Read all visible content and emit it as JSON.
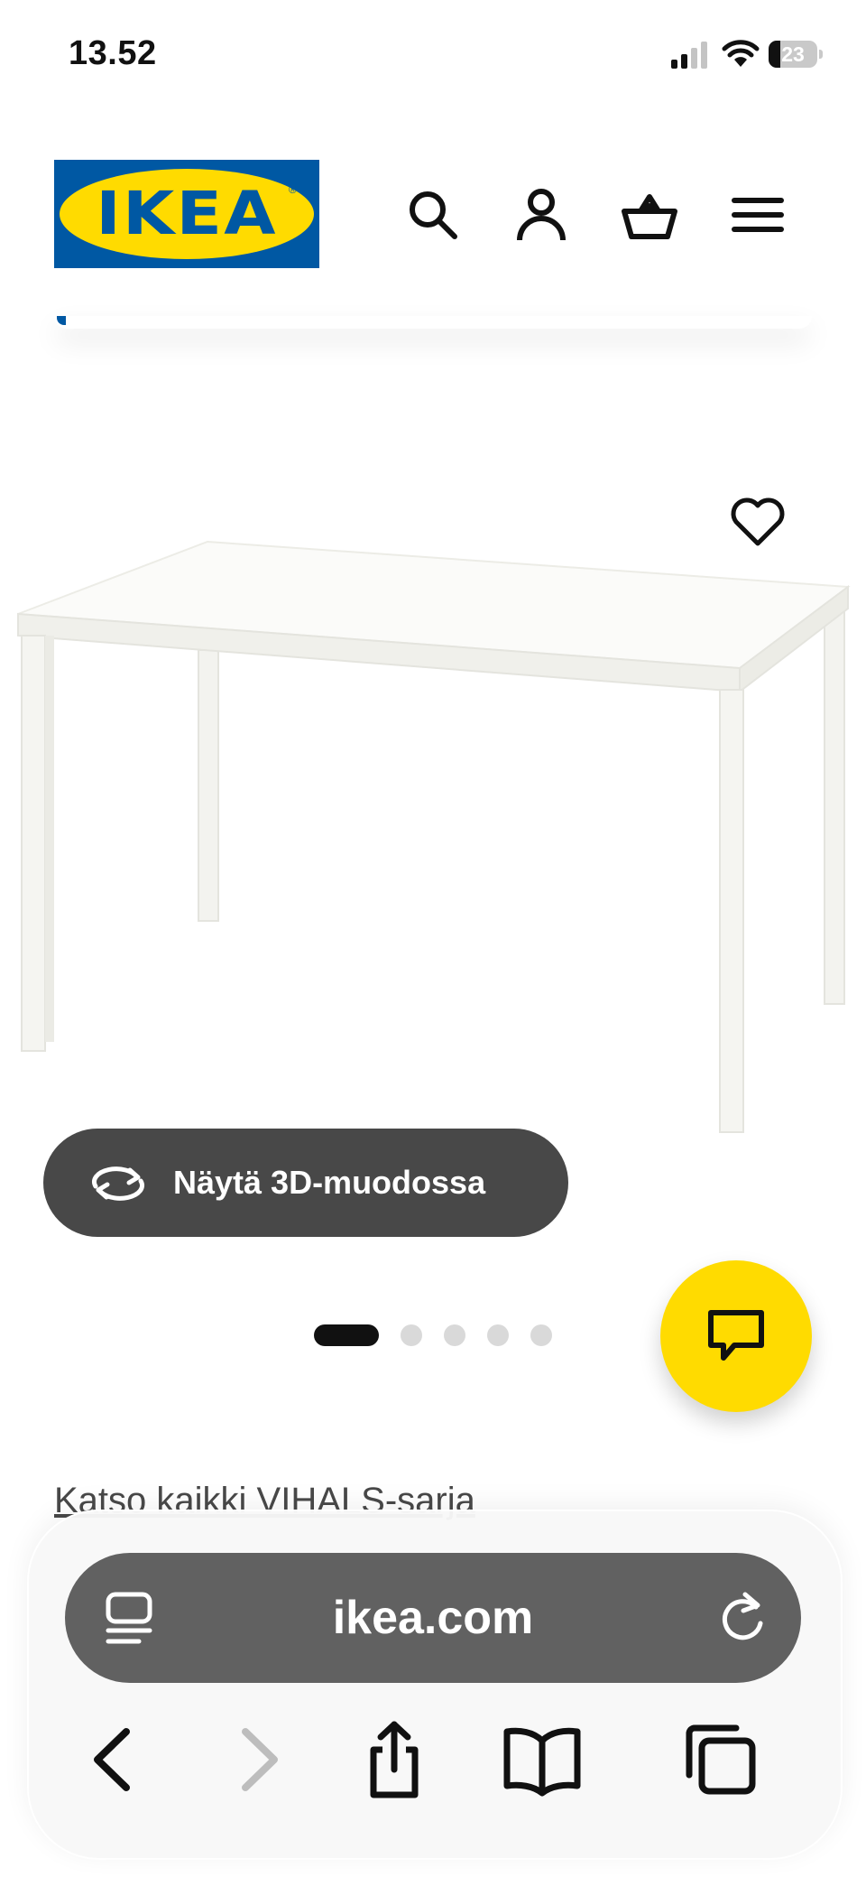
{
  "status_bar": {
    "time": "13.52",
    "battery_level": "23",
    "icons": [
      "cellular-signal-icon",
      "wifi-icon",
      "battery-icon"
    ]
  },
  "header": {
    "logo_text": "IKEA",
    "logo_colors": {
      "blue": "#0058a3",
      "yellow": "#ffdb00"
    },
    "icons": [
      "search-icon",
      "account-icon",
      "shopping-basket-icon",
      "menu-icon"
    ]
  },
  "product": {
    "favorite_icon": "heart-icon",
    "view_3d_label": "Näytä 3D-muodossa",
    "view_3d_icon": "rotate-3d-icon",
    "carousel": {
      "total": 5,
      "active_index": 0
    },
    "series_link": "Katso kaikki VIHALS-sarja"
  },
  "chat": {
    "icon": "chat-bubble-icon",
    "color": "#ffdb00"
  },
  "browser": {
    "url": "ikea.com",
    "page_menu_icon": "page-format-icon",
    "reload_icon": "reload-icon",
    "toolbar_icons": [
      "back-icon",
      "forward-icon",
      "share-icon",
      "bookmarks-icon",
      "tabs-icon"
    ]
  }
}
